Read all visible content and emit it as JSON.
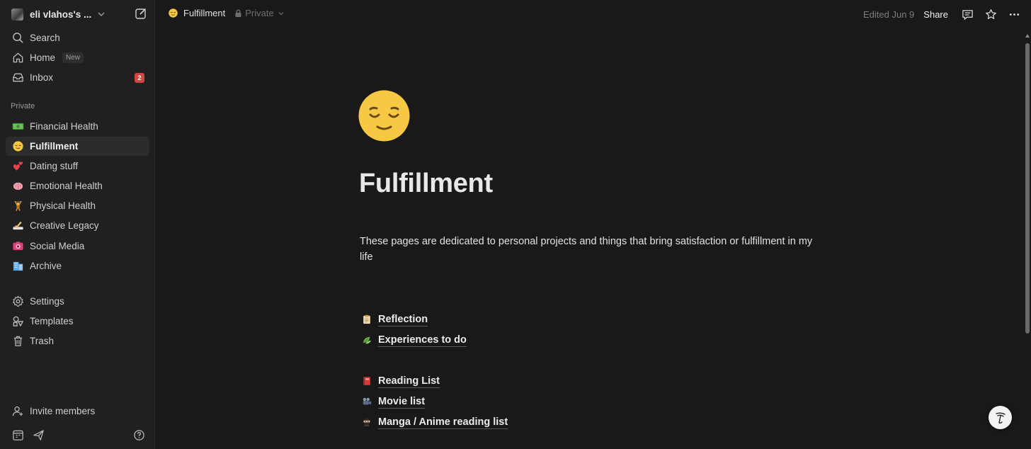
{
  "workspace": {
    "name": "eli vlahos's ..."
  },
  "nav": {
    "search": "Search",
    "home": "Home",
    "home_badge": "New",
    "inbox": "Inbox",
    "inbox_count": "2"
  },
  "private_section": {
    "label": "Private",
    "pages": [
      {
        "label": "Financial Health",
        "icon": "money-icon"
      },
      {
        "label": "Fulfillment",
        "icon": "relieved-face-icon"
      },
      {
        "label": "Dating stuff",
        "icon": "hearts-icon"
      },
      {
        "label": "Emotional Health",
        "icon": "brain-icon"
      },
      {
        "label": "Physical Health",
        "icon": "weightlifter-icon"
      },
      {
        "label": "Creative Legacy",
        "icon": "writing-hand-icon"
      },
      {
        "label": "Social Media",
        "icon": "camera-icon"
      },
      {
        "label": "Archive",
        "icon": "building-icon"
      }
    ]
  },
  "utility": {
    "settings": "Settings",
    "templates": "Templates",
    "trash": "Trash",
    "invite": "Invite members"
  },
  "topbar": {
    "page_title": "Fulfillment",
    "privacy": "Private",
    "edited": "Edited Jun 9",
    "share": "Share"
  },
  "page": {
    "title": "Fulfillment",
    "description": "These pages are dedicated to personal projects and things that bring satisfaction or fulfillment in my life",
    "links": [
      {
        "label": "Reflection",
        "icon": "clipboard-icon"
      },
      {
        "label": "Experiences to do",
        "icon": "leaves-icon"
      },
      {
        "label": "Reading List",
        "icon": "red-book-icon"
      },
      {
        "label": "Movie list",
        "icon": "movie-camera-icon"
      },
      {
        "label": "Manga / Anime reading list",
        "icon": "ninja-icon"
      }
    ]
  },
  "colors": {
    "background": "#191919",
    "sidebar": "#202020",
    "badge_red": "#d0463c",
    "emoji_yellow": "#f7c844"
  }
}
